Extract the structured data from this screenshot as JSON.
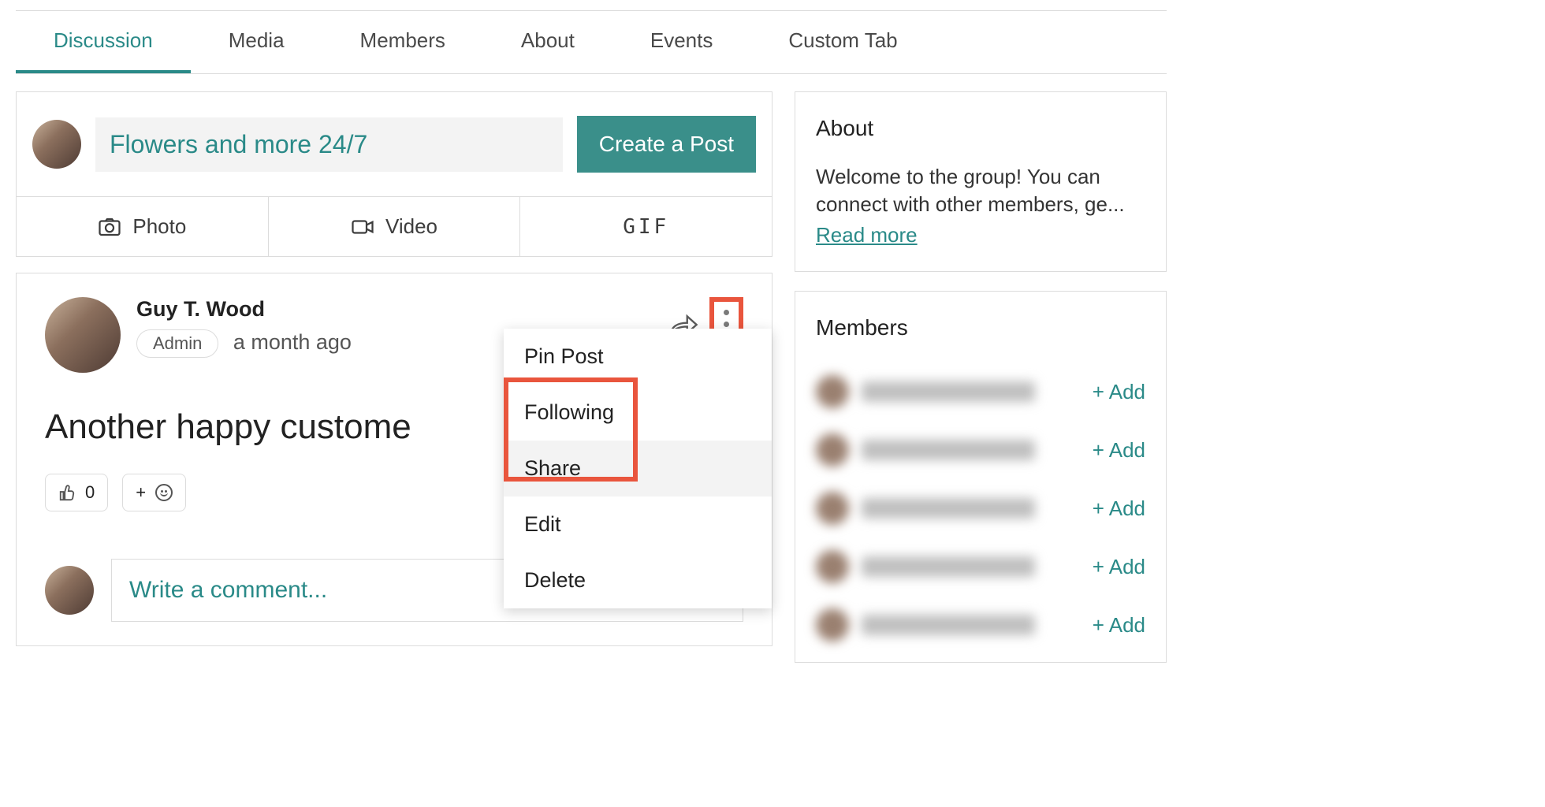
{
  "tabs": [
    "Discussion",
    "Media",
    "Members",
    "About",
    "Events",
    "Custom Tab"
  ],
  "activeTab": 0,
  "composer": {
    "placeholder": "Flowers and more 24/7",
    "createLabel": "Create a Post",
    "actions": {
      "photo": "Photo",
      "video": "Video",
      "gif": "GIF"
    }
  },
  "post": {
    "author": "Guy T. Wood",
    "badge": "Admin",
    "time": "a month ago",
    "body": "Another happy custome",
    "likeCount": "0",
    "addReact": "+",
    "menu": [
      "Pin Post",
      "Following",
      "Share",
      "Edit",
      "Delete"
    ],
    "hoverIndex": 2,
    "commentPlaceholder": "Write a comment..."
  },
  "about": {
    "title": "About",
    "text": "Welcome to the group! You can connect with other members, ge...",
    "readMore": "Read more"
  },
  "members": {
    "title": "Members",
    "addLabel": "+ Add",
    "count": 5
  }
}
